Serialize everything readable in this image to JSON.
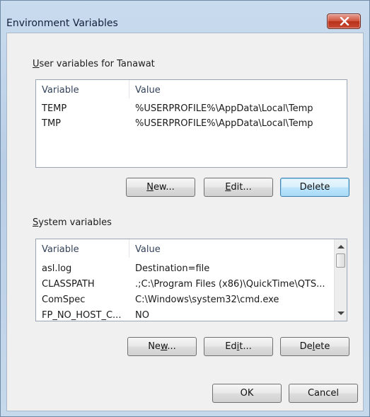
{
  "window": {
    "title": "Environment Variables",
    "close_icon": "close-x-icon"
  },
  "user_vars": {
    "group_label_accel": "U",
    "group_label_rest": "ser variables for Tanawat",
    "columns": [
      "Variable",
      "Value"
    ],
    "rows": [
      {
        "variable": "TEMP",
        "value": "%USERPROFILE%\\AppData\\Local\\Temp"
      },
      {
        "variable": "TMP",
        "value": "%USERPROFILE%\\AppData\\Local\\Temp"
      }
    ],
    "new_label_accel": "N",
    "new_label_rest": "ew...",
    "edit_label_accel": "E",
    "edit_label_rest": "dit...",
    "delete_label": "Delete"
  },
  "system_vars": {
    "group_label_accel": "S",
    "group_label_rest": "ystem variables",
    "columns": [
      "Variable",
      "Value"
    ],
    "rows": [
      {
        "variable": "asl.log",
        "value": "Destination=file"
      },
      {
        "variable": "CLASSPATH",
        "value": ".;C:\\Program Files (x86)\\QuickTime\\QTS..."
      },
      {
        "variable": "ComSpec",
        "value": "C:\\Windows\\system32\\cmd.exe"
      },
      {
        "variable": "FP_NO_HOST_C...",
        "value": "NO"
      }
    ],
    "new_label_pre": "Ne",
    "new_label_accel": "w",
    "new_label_post": "...",
    "edit_label_pre": "Ed",
    "edit_label_accel": "i",
    "edit_label_post": "t...",
    "delete_label_pre": "De",
    "delete_label_accel": "l",
    "delete_label_post": "ete"
  },
  "footer": {
    "ok_label": "OK",
    "cancel_label": "Cancel"
  }
}
